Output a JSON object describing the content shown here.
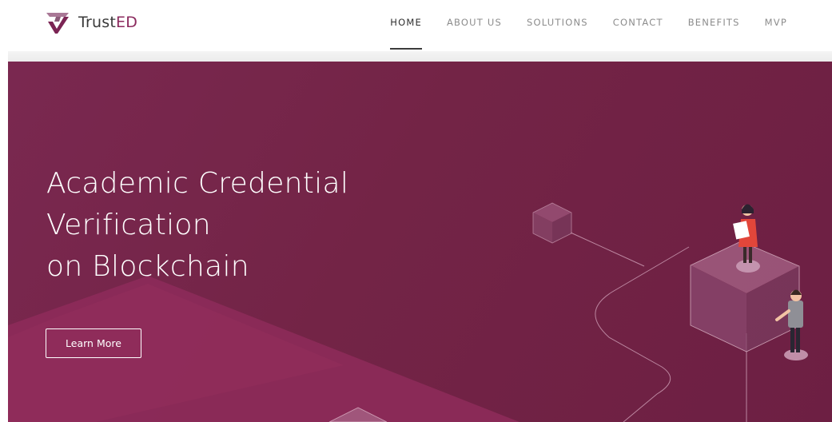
{
  "brand": {
    "name_main": "Trust",
    "name_accent": "ED",
    "logo_icon": "trusted-logo-icon"
  },
  "nav": {
    "items": [
      {
        "label": "HOME",
        "active": true
      },
      {
        "label": "ABOUT US",
        "active": false
      },
      {
        "label": "SOLUTIONS",
        "active": false
      },
      {
        "label": "CONTACT",
        "active": false
      },
      {
        "label": "BENEFITS",
        "active": false
      },
      {
        "label": "MVP",
        "active": false
      }
    ]
  },
  "hero": {
    "headline_line1": "Academic Credential",
    "headline_line2": "Verification",
    "headline_line3": "on Blockchain",
    "cta_label": "Learn More",
    "illustration": "blockchain-cubes-people-illustration"
  },
  "colors": {
    "accent": "#8b2a5e",
    "hero_background": "#752549",
    "text_on_hero": "#ffffff"
  }
}
